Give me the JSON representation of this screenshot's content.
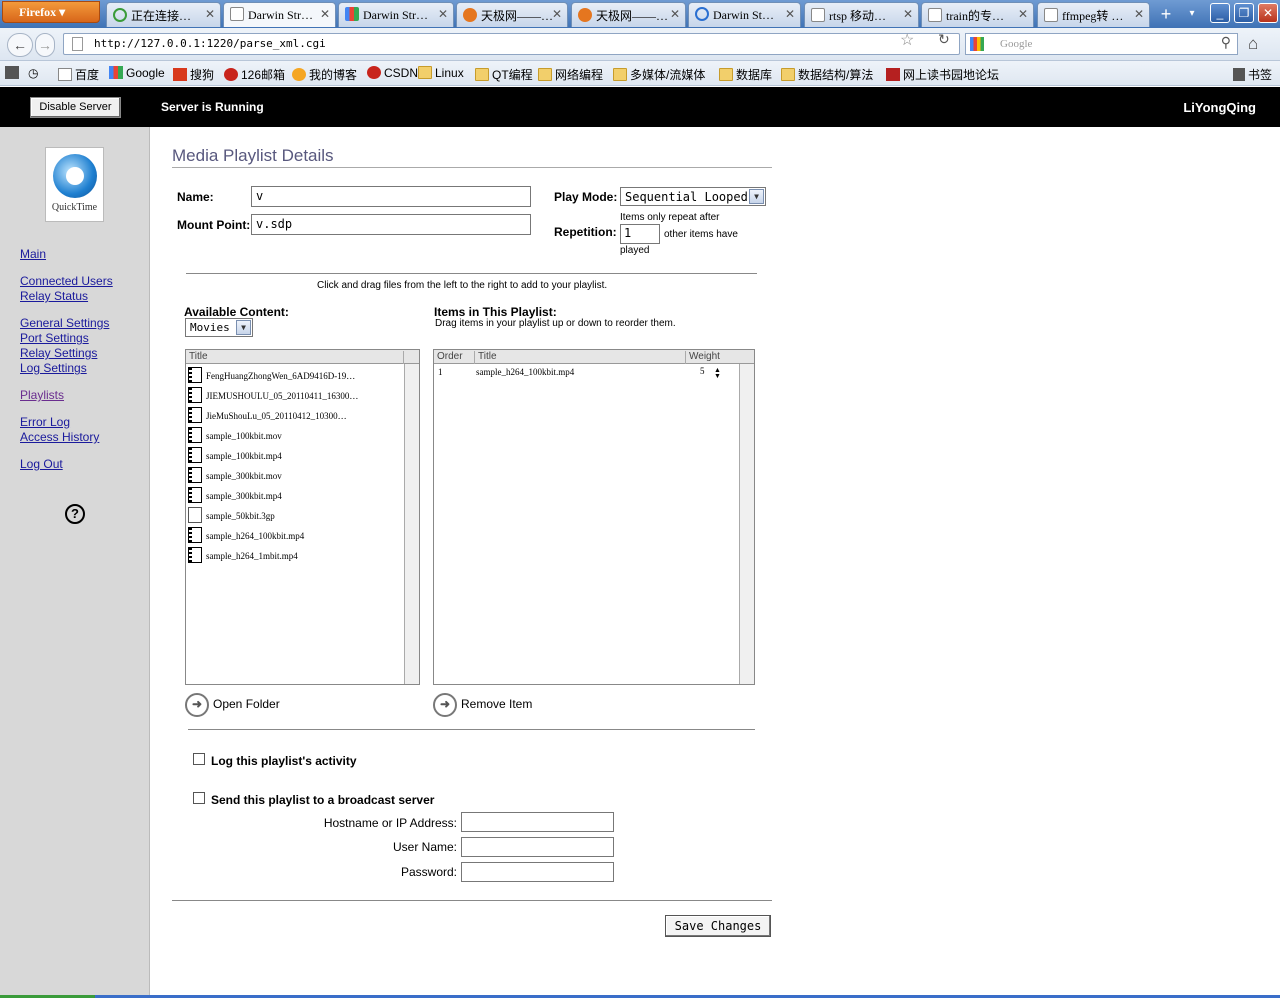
{
  "browser": {
    "menu_label": "Firefox",
    "tabs": [
      {
        "label": "正在连接…"
      },
      {
        "label": "Darwin Str…"
      },
      {
        "label": "Darwin Str…"
      },
      {
        "label": "天极网——…"
      },
      {
        "label": "天极网——…"
      },
      {
        "label": "Darwin  St…"
      },
      {
        "label": "rtsp 移动…"
      },
      {
        "label": "train的专…"
      },
      {
        "label": "ffmpeg转 …"
      }
    ],
    "url": "http://127.0.0.1:1220/parse_xml.cgi",
    "search_placeholder": "Google",
    "bookmarks": [
      {
        "label": "百度"
      },
      {
        "label": "Google"
      },
      {
        "label": "搜狗"
      },
      {
        "label": "126邮箱"
      },
      {
        "label": "我的博客"
      },
      {
        "label": "CSDN"
      },
      {
        "label": "Linux"
      },
      {
        "label": "QT编程"
      },
      {
        "label": "网络编程"
      },
      {
        "label": "多媒体/流媒体"
      },
      {
        "label": "数据库"
      },
      {
        "label": "数据结构/算法"
      },
      {
        "label": "网上读书园地论坛"
      }
    ],
    "bookmarks_menu": "书签"
  },
  "header": {
    "disable_button": "Disable Server",
    "status": "Server is Running",
    "hostname": "LiYongQing"
  },
  "sidebar": {
    "logo_label": "QuickTime",
    "links": {
      "main": "Main",
      "connected_users": "Connected Users",
      "relay_status": "Relay Status",
      "general_settings": "General Settings",
      "port_settings": "Port Settings",
      "relay_settings": "Relay Settings",
      "log_settings": "Log Settings",
      "playlists": "Playlists",
      "error_log": "Error Log",
      "access_history": "Access History",
      "log_out": "Log Out"
    },
    "help": "?"
  },
  "page": {
    "title": "Media Playlist Details",
    "name_label": "Name:",
    "name_value": "v",
    "mount_label": "Mount Point:",
    "mount_value": "v.sdp",
    "play_mode_label": "Play Mode:",
    "play_mode_value": "Sequential Looped",
    "repetition_label": "Repetition:",
    "repetition_pre": "Items only repeat after",
    "repetition_value": "1",
    "repetition_post": "other items have",
    "repetition_post2": "played",
    "drag_hint": "Click and drag files from the left to the right to add to your playlist.",
    "available_label": "Available Content:",
    "available_select": "Movies",
    "items_label": "Items in This Playlist:",
    "items_hint": "Drag items in your playlist up or down to reorder them.",
    "available_col_title": "Title",
    "available_files": [
      {
        "name": "FengHuangZhongWen_6AD9416D-19…",
        "icon": "film-icon"
      },
      {
        "name": "JIEMUSHOULU_05_20110411_16300…",
        "icon": "film-icon"
      },
      {
        "name": "JieMuShouLu_05_20110412_10300…",
        "icon": "film-icon"
      },
      {
        "name": "sample_100kbit.mov",
        "icon": "film-icon"
      },
      {
        "name": "sample_100kbit.mp4",
        "icon": "film-icon"
      },
      {
        "name": "sample_300kbit.mov",
        "icon": "film-icon"
      },
      {
        "name": "sample_300kbit.mp4",
        "icon": "film-icon"
      },
      {
        "name": "sample_50kbit.3gp",
        "icon": "document-icon"
      },
      {
        "name": "sample_h264_100kbit.mp4",
        "icon": "film-icon"
      },
      {
        "name": "sample_h264_1mbit.mp4",
        "icon": "film-icon"
      }
    ],
    "playlist_cols": {
      "order": "Order",
      "title": "Title",
      "weight": "Weight"
    },
    "playlist_items": [
      {
        "order": "1",
        "title": "sample_h264_100kbit.mp4",
        "weight": "5"
      }
    ],
    "open_folder": "Open Folder",
    "remove_item": "Remove Item",
    "log_activity": "Log this playlist's activity",
    "broadcast": "Send this playlist to a broadcast server",
    "hostname_label": "Hostname or IP Address:",
    "username_label": "User Name:",
    "password_label": "Password:",
    "save": "Save Changes"
  }
}
